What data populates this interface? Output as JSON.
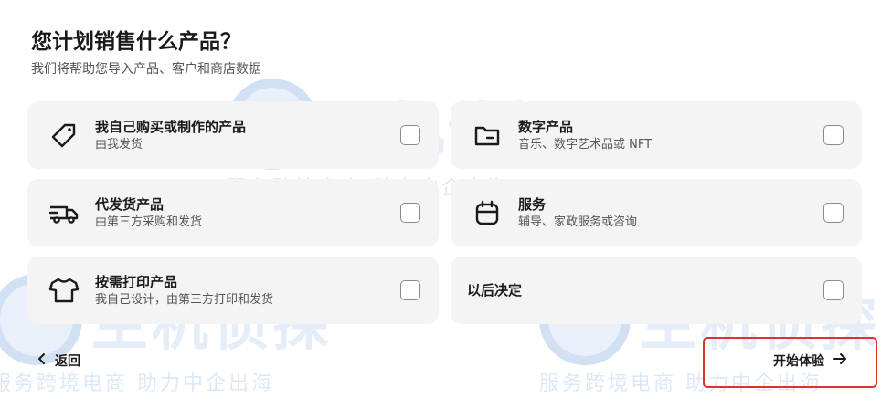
{
  "header": {
    "title": "您计划销售什么产品？",
    "subtitle": "我们将帮助您导入产品、客户和商店数据"
  },
  "options": [
    {
      "label": "我自己购买或制作的产品",
      "desc": "由我发货",
      "icon": "tag-icon",
      "checked": false
    },
    {
      "label": "数字产品",
      "desc": "音乐、数字艺术品或 NFT",
      "icon": "folder-icon",
      "checked": false
    },
    {
      "label": "代发货产品",
      "desc": "由第三方采购和发货",
      "icon": "truck-icon",
      "checked": false
    },
    {
      "label": "服务",
      "desc": "辅导、家政服务或咨询",
      "icon": "calendar-icon",
      "checked": false
    },
    {
      "label": "按需打印产品",
      "desc": "我自己设计，由第三方打印和发货",
      "icon": "tshirt-icon",
      "checked": false
    },
    {
      "label": "以后决定",
      "checked": false
    }
  ],
  "footer": {
    "back_label": "返回",
    "start_label": "开始体验"
  },
  "watermark": {
    "brand": "主机侦探",
    "slogan": "服务跨境电商 助力中企出海"
  },
  "colors": {
    "card_bg": "#f4f4f4",
    "highlight_border": "#d9352b",
    "watermark": "#2c6ec4"
  }
}
